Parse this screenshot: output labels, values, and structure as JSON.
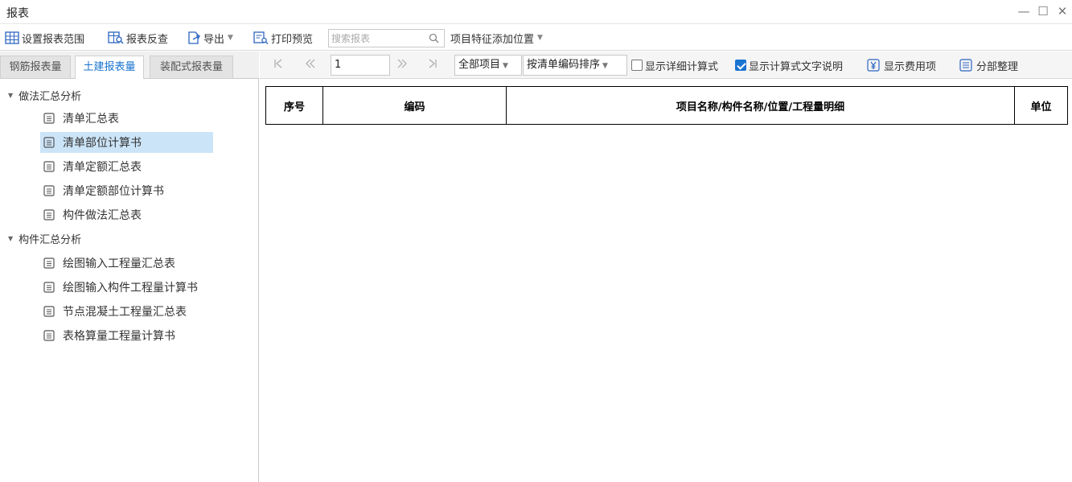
{
  "window": {
    "title": "报表",
    "minimize_glyph": "—",
    "maximize_glyph": "☐",
    "close_glyph": "✕"
  },
  "toolbar": {
    "set_range": "设置报表范围",
    "reverse_check": "报表反查",
    "export": "导出",
    "print_preview": "打印预览",
    "search_placeholder": "搜索报表",
    "feature_position": "项目特征添加位置"
  },
  "left_tabs": [
    {
      "label": "钢筋报表量",
      "active": false
    },
    {
      "label": "土建报表量",
      "active": true
    },
    {
      "label": "装配式报表量",
      "active": false
    }
  ],
  "tree": {
    "groups": [
      {
        "label": "做法汇总分析",
        "items": [
          "清单汇总表",
          "清单部位计算书",
          "清单定额汇总表",
          "清单定额部位计算书",
          "构件做法汇总表"
        ]
      },
      {
        "label": "构件汇总分析",
        "items": [
          "绘图输入工程量汇总表",
          "绘图输入构件工程量计算书",
          "节点混凝土工程量汇总表",
          "表格算量工程量计算书"
        ]
      }
    ],
    "selected": "清单部位计算书"
  },
  "viewer": {
    "page": "1",
    "scope": "全部项目",
    "sort": "按清单编码排序",
    "show_detail_formula": "显示详细计算式",
    "show_detail_formula_checked": false,
    "show_formula_text": "显示计算式文字说明",
    "show_formula_text_checked": true,
    "show_fee": "显示费用项",
    "organize": "分部整理"
  },
  "report": {
    "columns": [
      "序号",
      "编码",
      "项目名称/构件名称/位置/工程量明细",
      "单位"
    ]
  },
  "colors": {
    "accent": "#1a74d1",
    "selected_row": "#cce4f7"
  }
}
